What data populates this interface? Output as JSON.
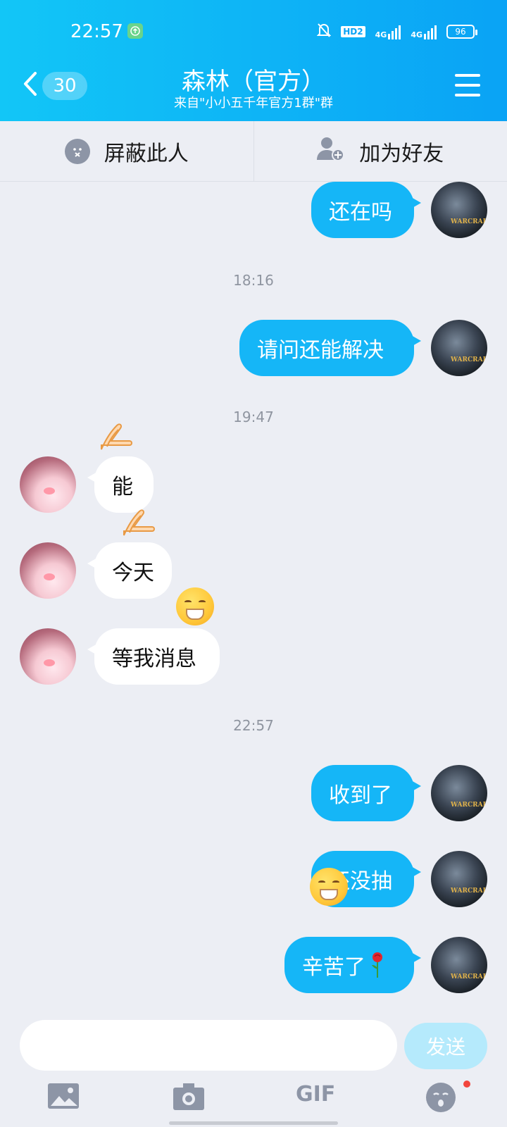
{
  "status_bar": {
    "time": "22:57",
    "hd_label": "HD2",
    "net1": "4G",
    "net2": "4G",
    "battery": "96"
  },
  "header": {
    "back_count": "30",
    "title": "森林（官方）",
    "subtitle": "来自\"小小五千年官方1群\"群"
  },
  "actions": {
    "block_label": "屏蔽此人",
    "add_friend_label": "加为好友"
  },
  "messages": [
    {
      "side": "mine",
      "text": "还在吗"
    },
    {
      "timestamp": "18:16"
    },
    {
      "side": "mine",
      "text": "请问还能解决"
    },
    {
      "timestamp": "19:47"
    },
    {
      "side": "theirs",
      "text": "能"
    },
    {
      "side": "theirs",
      "text": "今天"
    },
    {
      "side": "theirs",
      "text": "等我消息"
    },
    {
      "timestamp": "22:57"
    },
    {
      "side": "mine",
      "text": "收到了"
    },
    {
      "side": "mine",
      "text": "还没抽"
    },
    {
      "side": "mine",
      "text": "辛苦了"
    }
  ],
  "composer": {
    "send_label": "发送",
    "gif_label": "GIF"
  },
  "icons": {
    "block": "block-face-icon",
    "add_friend": "add-user-icon",
    "image": "image-icon",
    "camera": "camera-icon",
    "gif": "gif-icon",
    "emoji": "emoji-face-icon"
  },
  "colors": {
    "brand": "#0aa3f5",
    "mine_bubble": "#15b6f7",
    "theirs_bubble": "#ffffff",
    "send_disabled": "#b5eafc",
    "notification_dot": "#f2453d"
  }
}
